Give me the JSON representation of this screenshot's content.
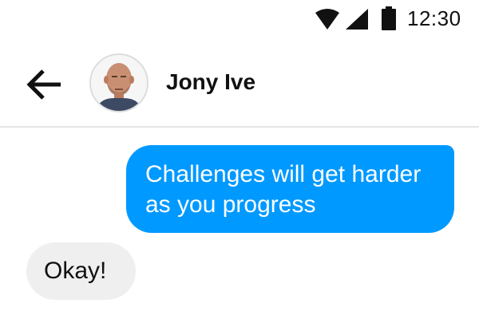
{
  "status_bar": {
    "time": "12:30",
    "icons": [
      "wifi-icon",
      "cellular-signal-icon",
      "battery-icon"
    ]
  },
  "header": {
    "back_icon": "arrow-left-icon",
    "contact_name": "Jony Ive",
    "avatar": "contact-avatar-photo"
  },
  "messages": [
    {
      "direction": "sent",
      "text": "Challenges will get harder as you progress"
    },
    {
      "direction": "received",
      "text": "Okay!"
    }
  ],
  "colors": {
    "sent_bubble": "#0099ff",
    "received_bubble": "#efefef",
    "divider": "#e4e4e4"
  }
}
